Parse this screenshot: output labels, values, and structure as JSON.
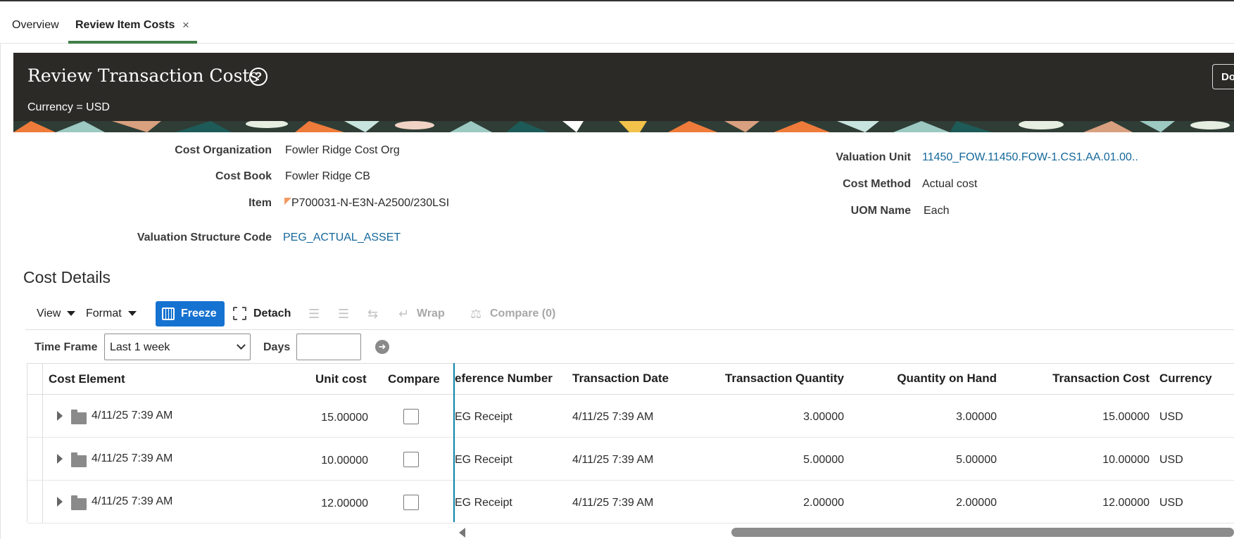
{
  "tabs": [
    {
      "label": "Overview"
    },
    {
      "label": "Review Item Costs",
      "close": "×"
    }
  ],
  "header": {
    "title": "Review Transaction Costs",
    "help": "?",
    "currency": "Currency = USD",
    "done_label": "Done"
  },
  "fields": {
    "cost_org_label": "Cost Organization",
    "cost_org_value": "Fowler Ridge Cost Org",
    "cost_book_label": "Cost Book",
    "cost_book_value": "Fowler Ridge CB",
    "item_label": "Item",
    "item_value": "P700031-N-E3N-A2500/230LSI",
    "vsc_label": "Valuation Structure Code",
    "vsc_value": "PEG_ACTUAL_ASSET",
    "valuation_unit_label": "Valuation Unit",
    "valuation_unit_value": "11450_FOW.11450.FOW-1.CS1.AA.01.00..",
    "cost_method_label": "Cost Method",
    "cost_method_value": "Actual cost",
    "uom_label": "UOM Name",
    "uom_value": "Each"
  },
  "section_title": "Cost Details",
  "toolbar": {
    "view": "View",
    "format": "Format",
    "freeze": "Freeze",
    "detach": "Detach",
    "wrap": "Wrap",
    "compare": "Compare (0)"
  },
  "filter": {
    "timeframe_label": "Time Frame",
    "timeframe_value": "Last 1 week",
    "days_label": "Days",
    "days_value": ""
  },
  "table": {
    "frozen_headers": {
      "cost_element": "Cost Element",
      "unit_cost": "Unit cost",
      "compare": "Compare"
    },
    "headers": {
      "ref": "eference Number",
      "date": "Transaction Date",
      "qty": "Transaction Quantity",
      "onhand": "Quantity on Hand",
      "cost": "Transaction Cost",
      "currency": "Currency"
    },
    "rows": [
      {
        "cost_element": "4/11/25 7:39 AM",
        "unit_cost": "15.00000",
        "ref": "EG Receipt",
        "date": "4/11/25 7:39 AM",
        "qty": "3.00000",
        "onhand": "3.00000",
        "cost": "15.00000",
        "currency": "USD"
      },
      {
        "cost_element": "4/11/25 7:39 AM",
        "unit_cost": "10.00000",
        "ref": "EG Receipt",
        "date": "4/11/25 7:39 AM",
        "qty": "5.00000",
        "onhand": "5.00000",
        "cost": "10.00000",
        "currency": "USD"
      },
      {
        "cost_element": "4/11/25 7:39 AM",
        "unit_cost": "12.00000",
        "ref": "EG Receipt",
        "date": "4/11/25 7:39 AM",
        "qty": "2.00000",
        "onhand": "2.00000",
        "cost": "12.00000",
        "currency": "USD"
      }
    ]
  },
  "colors": {
    "accent": "#1672d0",
    "header_bg": "#2b2a27",
    "link": "#14689a",
    "tab_underline": "#3f7f47"
  }
}
